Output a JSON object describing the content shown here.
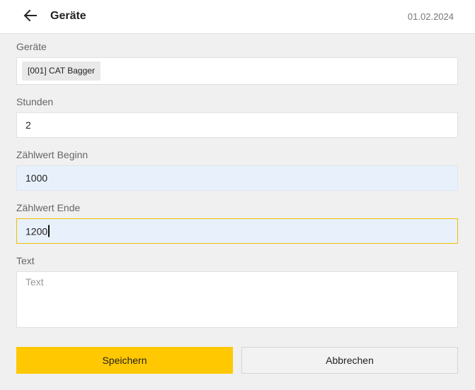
{
  "header": {
    "title": "Geräte",
    "date": "01.02.2024"
  },
  "form": {
    "devices": {
      "label": "Geräte",
      "chip": "[001] CAT Bagger"
    },
    "hours": {
      "label": "Stunden",
      "value": "2"
    },
    "counter_start": {
      "label": "Zählwert Beginn",
      "value": "1000"
    },
    "counter_end": {
      "label": "Zählwert Ende",
      "value": "1200"
    },
    "text": {
      "label": "Text",
      "placeholder": "Text"
    }
  },
  "actions": {
    "save": "Speichern",
    "cancel": "Abbrechen"
  },
  "colors": {
    "accent": "#ffc800",
    "readonly_bg": "#e8f0fc"
  }
}
